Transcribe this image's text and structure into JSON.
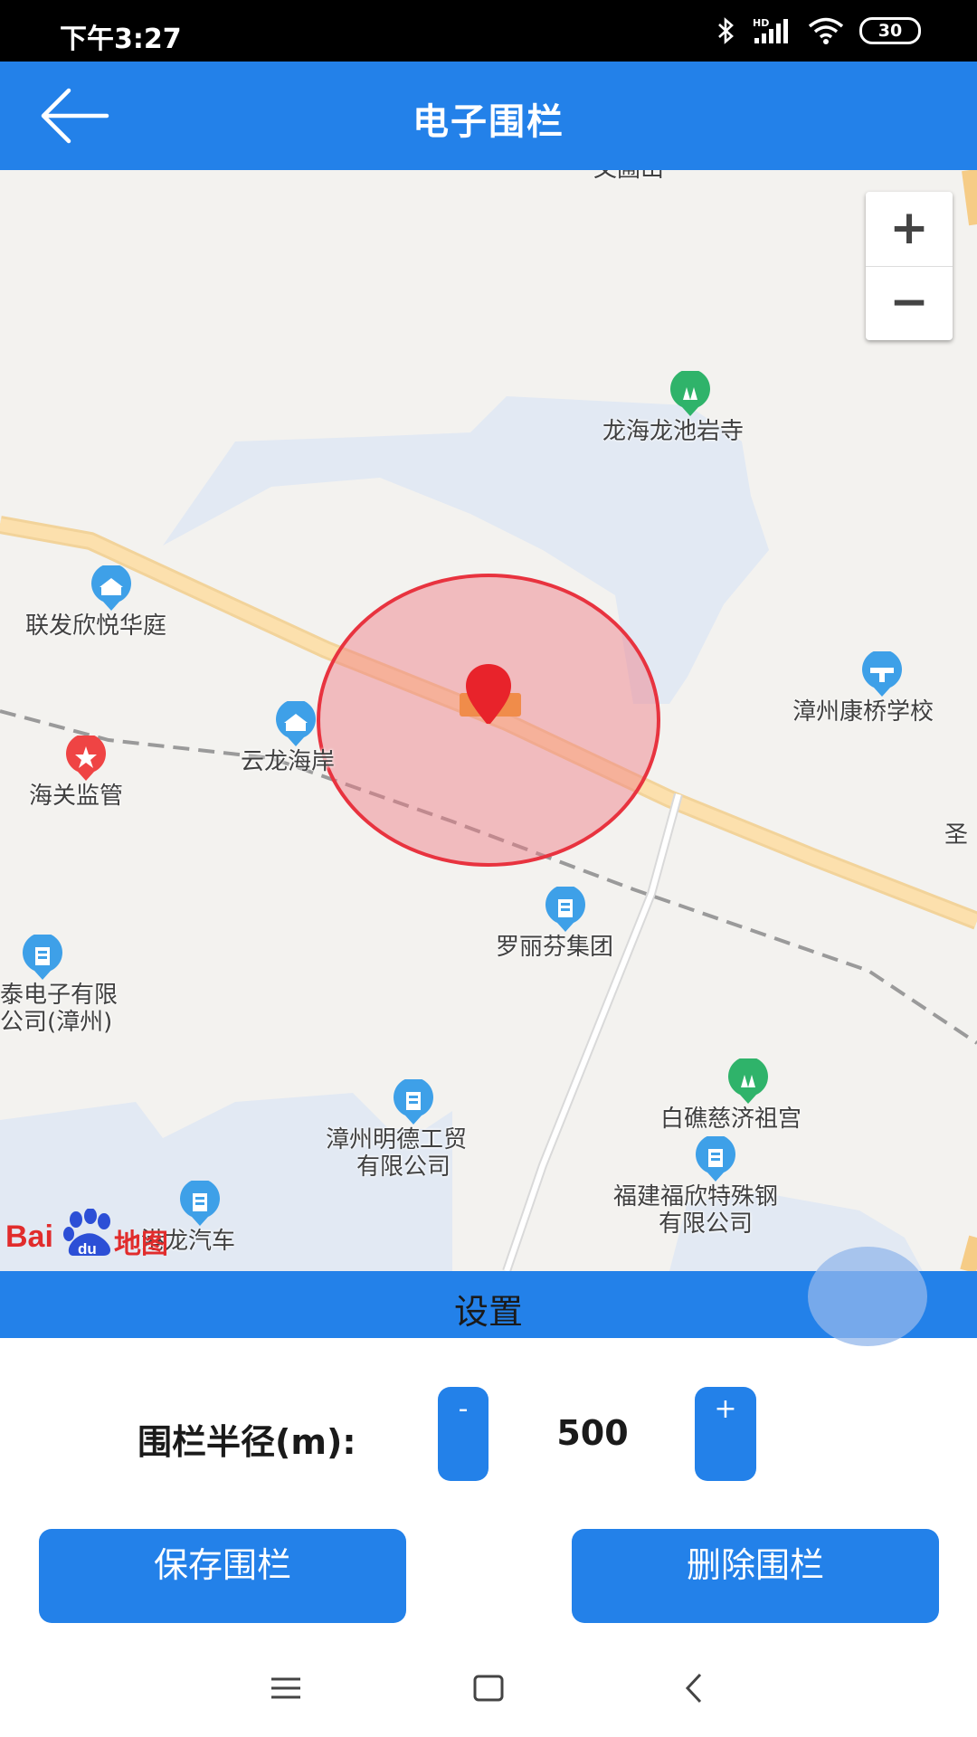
{
  "status_bar": {
    "time": "下午3:27",
    "battery": "30",
    "icons": [
      "bluetooth-icon",
      "hd-signal-icon",
      "wifi-icon",
      "battery-icon"
    ]
  },
  "header": {
    "title": "电子围栏",
    "back_icon": "arrow-left-icon"
  },
  "map": {
    "provider_logo": {
      "text": "Bai",
      "paw_text": "du",
      "suffix": "地图"
    },
    "zoom_in_label": "+",
    "zoom_out_label": "−",
    "fence": {
      "radius_m": 500,
      "color": "#f0595f"
    },
    "pois": [
      {
        "name": "龙海龙池岩寺",
        "icon": "park-icon"
      },
      {
        "name": "联发欣悦华庭",
        "icon": "residential-icon"
      },
      {
        "name": "漳州康桥学校",
        "icon": "school-icon"
      },
      {
        "name": "云龙海岸",
        "icon": "residential-icon"
      },
      {
        "name": "海关监管",
        "icon": "government-icon"
      },
      {
        "name": "罗丽芬集团",
        "icon": "company-icon"
      },
      {
        "name": "泰电子有限",
        "line2": "公司(漳州)",
        "icon": "company-icon"
      },
      {
        "name": "白礁慈济祖宫",
        "icon": "park-icon"
      },
      {
        "name": "漳州明德工贸",
        "line2": "有限公司",
        "icon": "company-icon"
      },
      {
        "name": "福建福欣特殊钢",
        "line2": "有限公司",
        "icon": "company-icon"
      },
      {
        "name": "港龙汽车",
        "icon": "company-icon"
      },
      {
        "name": "圣",
        "icon": ""
      },
      {
        "name": "文圃山",
        "icon": ""
      }
    ]
  },
  "settings": {
    "title": "设置",
    "radius_label": "围栏半径(m):",
    "minus_label": "-",
    "plus_label": "+",
    "radius_value": "500",
    "save_label": "保存围栏",
    "delete_label": "删除围栏"
  },
  "nav_bar": {
    "icons": [
      "menu-icon",
      "home-icon",
      "back-icon"
    ]
  },
  "colors": {
    "primary": "#2381e9",
    "road": "#fcd9a2",
    "water": "#e0e8f2",
    "map_bg": "#f3f2ef",
    "poi_blue": "#3ea0e8",
    "poi_green": "#2fb36a",
    "poi_red": "#ef4444"
  }
}
